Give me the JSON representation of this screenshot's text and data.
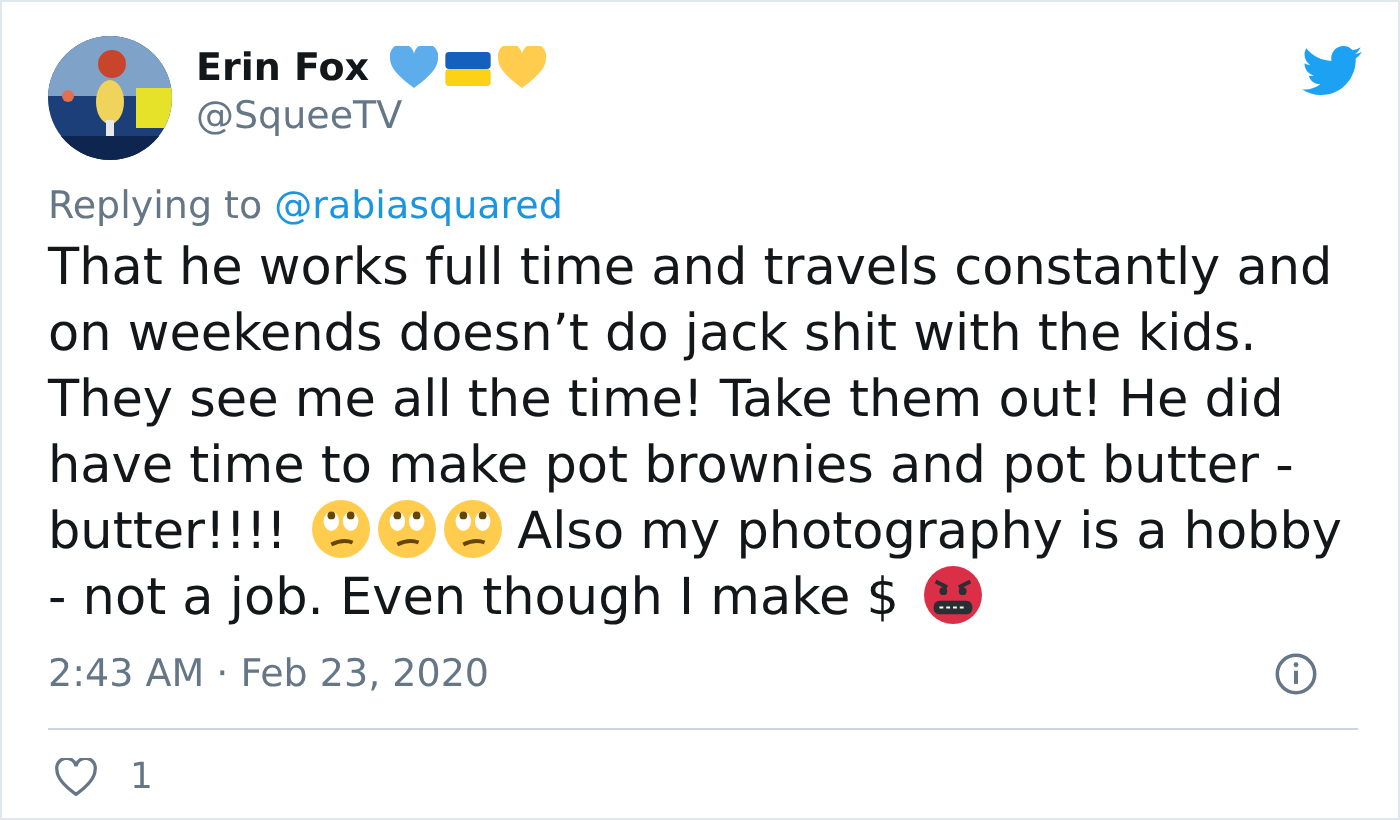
{
  "author": {
    "name": "Erin Fox",
    "handle": "@SqueeTV"
  },
  "reply": {
    "label": "Replying to",
    "mention": "@rabiasquared"
  },
  "body": [
    [
      "That he works full time and travels constantly and"
    ],
    [
      "on weekends doesn’t do jack shit with the kids."
    ],
    [
      "They see me all the time! Take them out! He did"
    ],
    [
      "have time to make pot brownies and pot butter -"
    ],
    [
      "butter!!!!",
      "Also my photography is a hobby"
    ],
    [
      "- not a job. Even though I make $"
    ]
  ],
  "timestamp": "2:43 AM · Feb 23, 2020",
  "likes": {
    "count": "1"
  }
}
